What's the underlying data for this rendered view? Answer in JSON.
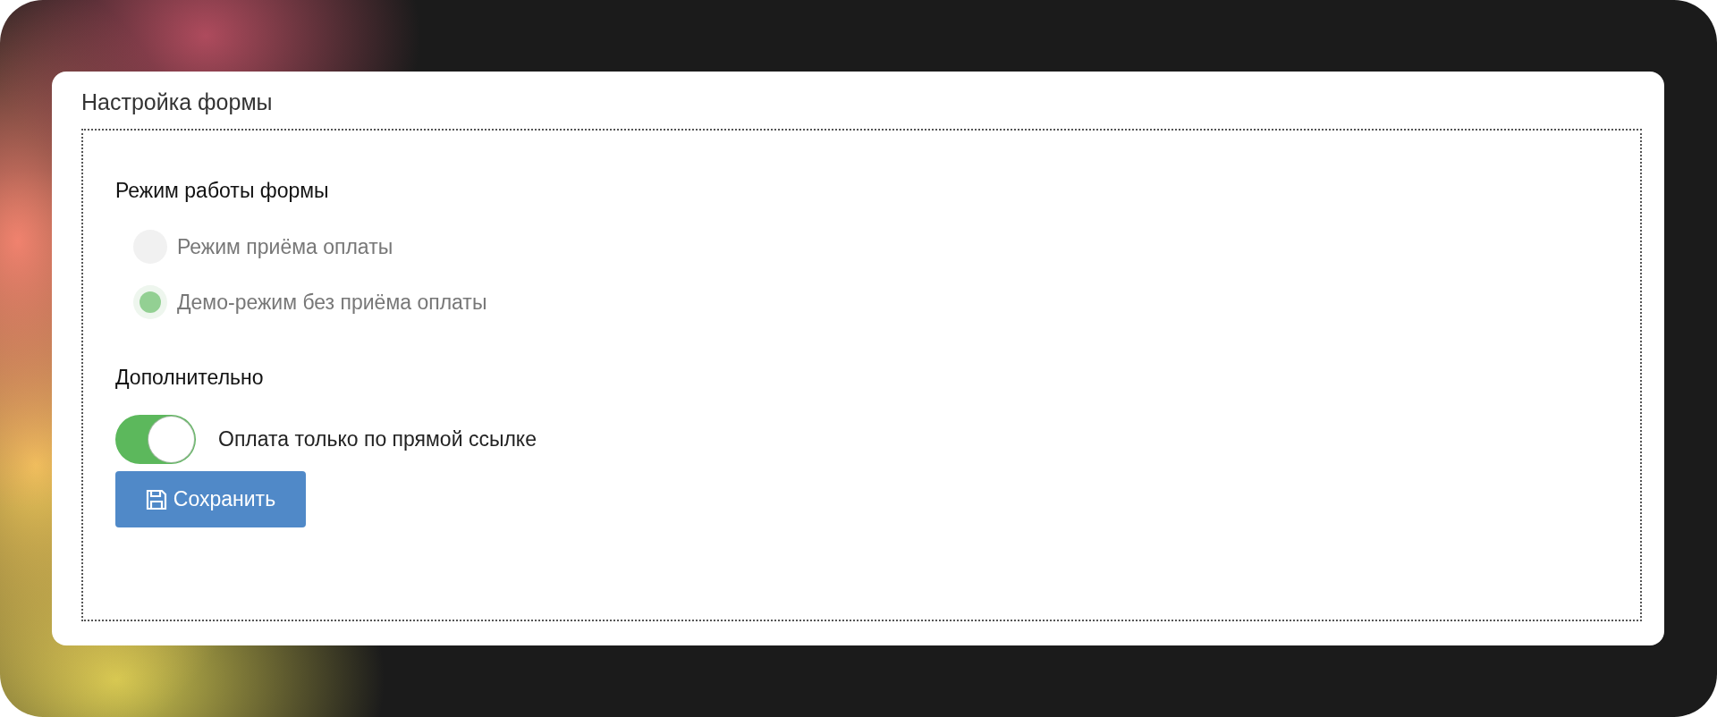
{
  "card": {
    "title": "Настройка формы"
  },
  "mode_section": {
    "heading": "Режим работы формы",
    "options": [
      {
        "label": "Режим приёма оплаты",
        "selected": false
      },
      {
        "label": "Демо-режим без приёма оплаты",
        "selected": true
      }
    ]
  },
  "extra_section": {
    "heading": "Дополнительно",
    "toggles": [
      {
        "label": "Оплата только по прямой ссылке",
        "on": true
      }
    ]
  },
  "save_button": {
    "label": "Сохранить"
  }
}
